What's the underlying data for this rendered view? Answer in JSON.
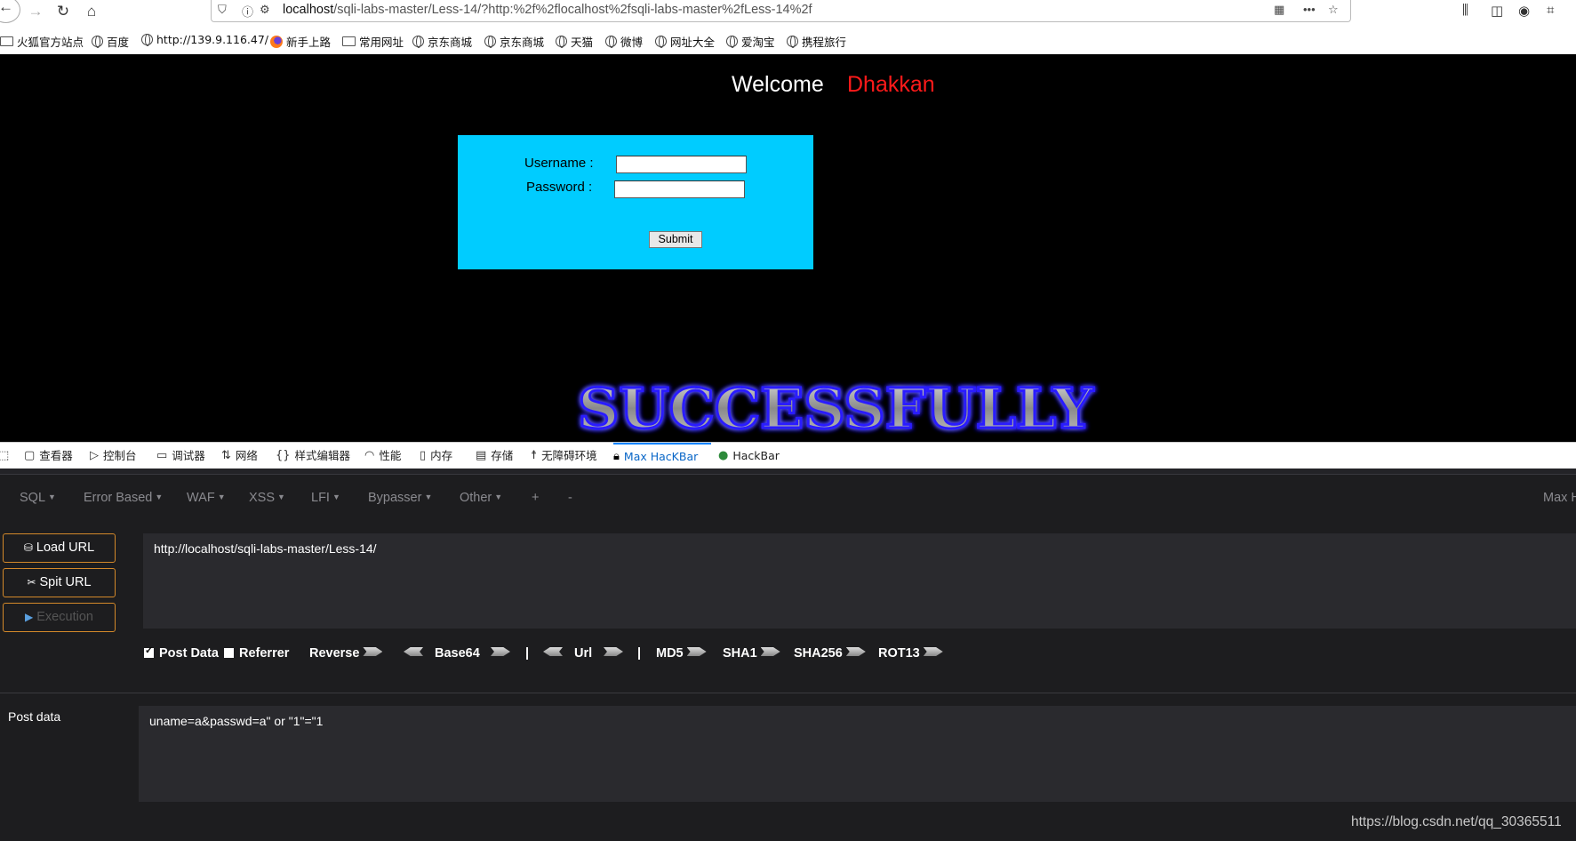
{
  "browser": {
    "url_host": "localhost",
    "url_path": "/sqli-labs-master/Less-14/?http:%2f%2flocalhost%2fsqli-labs-master%2fLess-14%2f",
    "bookmarks": [
      "火狐官方站点",
      "百度",
      "http://139.9.116.47/",
      "新手上路",
      "常用网址",
      "京东商城",
      "京东商城",
      "天猫",
      "微博",
      "网址大全",
      "爱淘宝",
      "携程旅行"
    ]
  },
  "page": {
    "welcome": "Welcome",
    "welcome_name": "Dhakkan",
    "username_label": "Username :",
    "password_label": "Password :",
    "submit_label": "Submit",
    "success_text": "SUCCESSFULLY",
    "colors": {
      "login_bg": "#00ccff",
      "name_color": "#ff1a1a"
    }
  },
  "devtools": {
    "tabs": [
      "查看器",
      "控制台",
      "调试器",
      "网络",
      "样式编辑器",
      "性能",
      "内存",
      "存储",
      "无障碍环境",
      "Max HacKBar",
      "HackBar"
    ],
    "active_tab": "Max HacKBar"
  },
  "hackbar": {
    "menu": [
      "SQL",
      "Error Based",
      "WAF",
      "XSS",
      "LFI",
      "Bypasser",
      "Other",
      "+",
      "-"
    ],
    "brand_partial": "Max H",
    "buttons": {
      "load_url": "Load URL",
      "split_url": "Spit URL",
      "execution": "Execution"
    },
    "url_value": "http://localhost/sqli-labs-master/Less-14/",
    "options": {
      "post_data": "Post Data",
      "referrer": "Referrer",
      "reverse": "Reverse",
      "base64": "Base64",
      "url": "Url",
      "md5": "MD5",
      "sha1": "SHA1",
      "sha256": "SHA256",
      "rot13": "ROT13",
      "pipe": "|",
      "post_data_checked": true,
      "referrer_checked": false
    },
    "post_label": "Post data",
    "post_value": "uname=a&passwd=a\" or \"1\"=\"1"
  },
  "watermark": "https://blog.csdn.net/qq_30365511"
}
